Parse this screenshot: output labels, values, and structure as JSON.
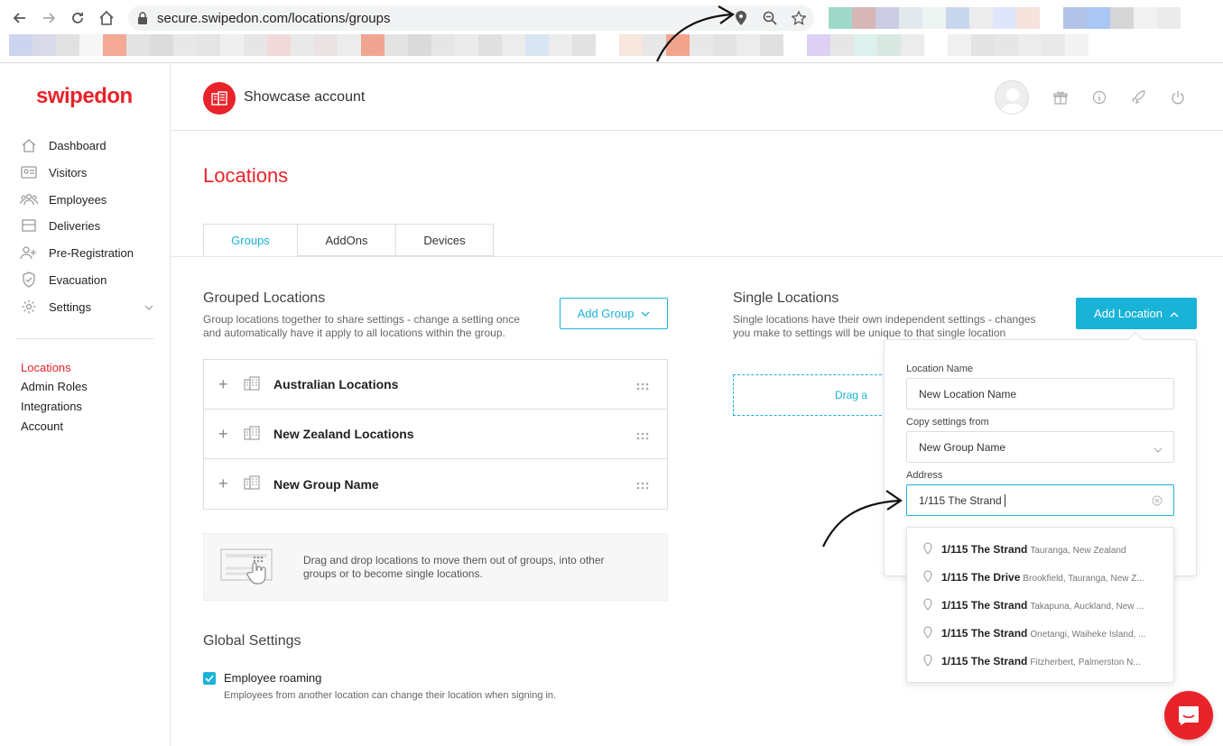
{
  "browser": {
    "url": "secure.swipedon.com/locations/groups",
    "icons": [
      "back-icon",
      "forward-icon",
      "reload-icon",
      "home-icon",
      "lock-icon",
      "location-pin-icon",
      "zoom-icon",
      "star-icon"
    ]
  },
  "brand": {
    "logo": "swipedon",
    "accent": "#e8232a",
    "primary": "#1ab3d8"
  },
  "sidebar": {
    "items": [
      {
        "label": "Dashboard",
        "icon": "home-icon"
      },
      {
        "label": "Visitors",
        "icon": "id-card-icon"
      },
      {
        "label": "Employees",
        "icon": "people-icon"
      },
      {
        "label": "Deliveries",
        "icon": "package-icon"
      },
      {
        "label": "Pre-Registration",
        "icon": "user-plus-icon"
      },
      {
        "label": "Evacuation",
        "icon": "shield-icon"
      },
      {
        "label": "Settings",
        "icon": "gear-icon"
      }
    ],
    "sub_items": [
      "Locations",
      "Admin Roles",
      "Integrations",
      "Account"
    ],
    "active_sub": "Locations"
  },
  "header": {
    "account_name": "Showcase account",
    "icons": [
      "avatar",
      "gift-icon",
      "info-icon",
      "rocket-icon",
      "power-icon"
    ]
  },
  "page": {
    "title": "Locations",
    "tabs": [
      "Groups",
      "AddOns",
      "Devices"
    ],
    "active_tab": "Groups"
  },
  "grouped": {
    "title": "Grouped Locations",
    "description_1": "Group locations together to share settings - change a setting once",
    "description_2": "and automatically have it apply to all locations within the group.",
    "add_button": "Add Group",
    "groups": [
      "Australian Locations",
      "New Zealand Locations",
      "New Group Name"
    ],
    "dragdrop_1": "Drag and drop locations to move them out of groups, into other",
    "dragdrop_2": "groups or to become single locations."
  },
  "global_settings": {
    "title": "Global Settings",
    "roaming_label": "Employee roaming",
    "roaming_checked": true,
    "roaming_desc": "Employees from another location can change their location when signing in."
  },
  "single": {
    "title": "Single Locations",
    "description_1": "Single locations have their own independent settings - changes",
    "description_2": "you make to settings will be unique to that single location",
    "add_button": "Add Location",
    "drop_hint": "Drag a"
  },
  "add_location_form": {
    "name_label": "Location Name",
    "name_placeholder": "New Location Name",
    "copy_label": "Copy settings from",
    "copy_value": "New Group Name",
    "address_label": "Address",
    "address_value": "1/115 The Strand"
  },
  "suggestions": [
    {
      "bold": "1/115 The Strand",
      "secondary": "Tauranga, New Zealand"
    },
    {
      "bold": "1/115 The Drive",
      "secondary": "Brookfield, Tauranga, New Z..."
    },
    {
      "bold": "1/115 The Strand",
      "secondary": "Takapuna, Auckland, New ..."
    },
    {
      "bold": "1/115 The Strand",
      "secondary": "Onetangi, Waiheke Island, ..."
    },
    {
      "bold": "1/115 The Strand",
      "secondary": "Fitzherbert, Palmerston N..."
    }
  ]
}
